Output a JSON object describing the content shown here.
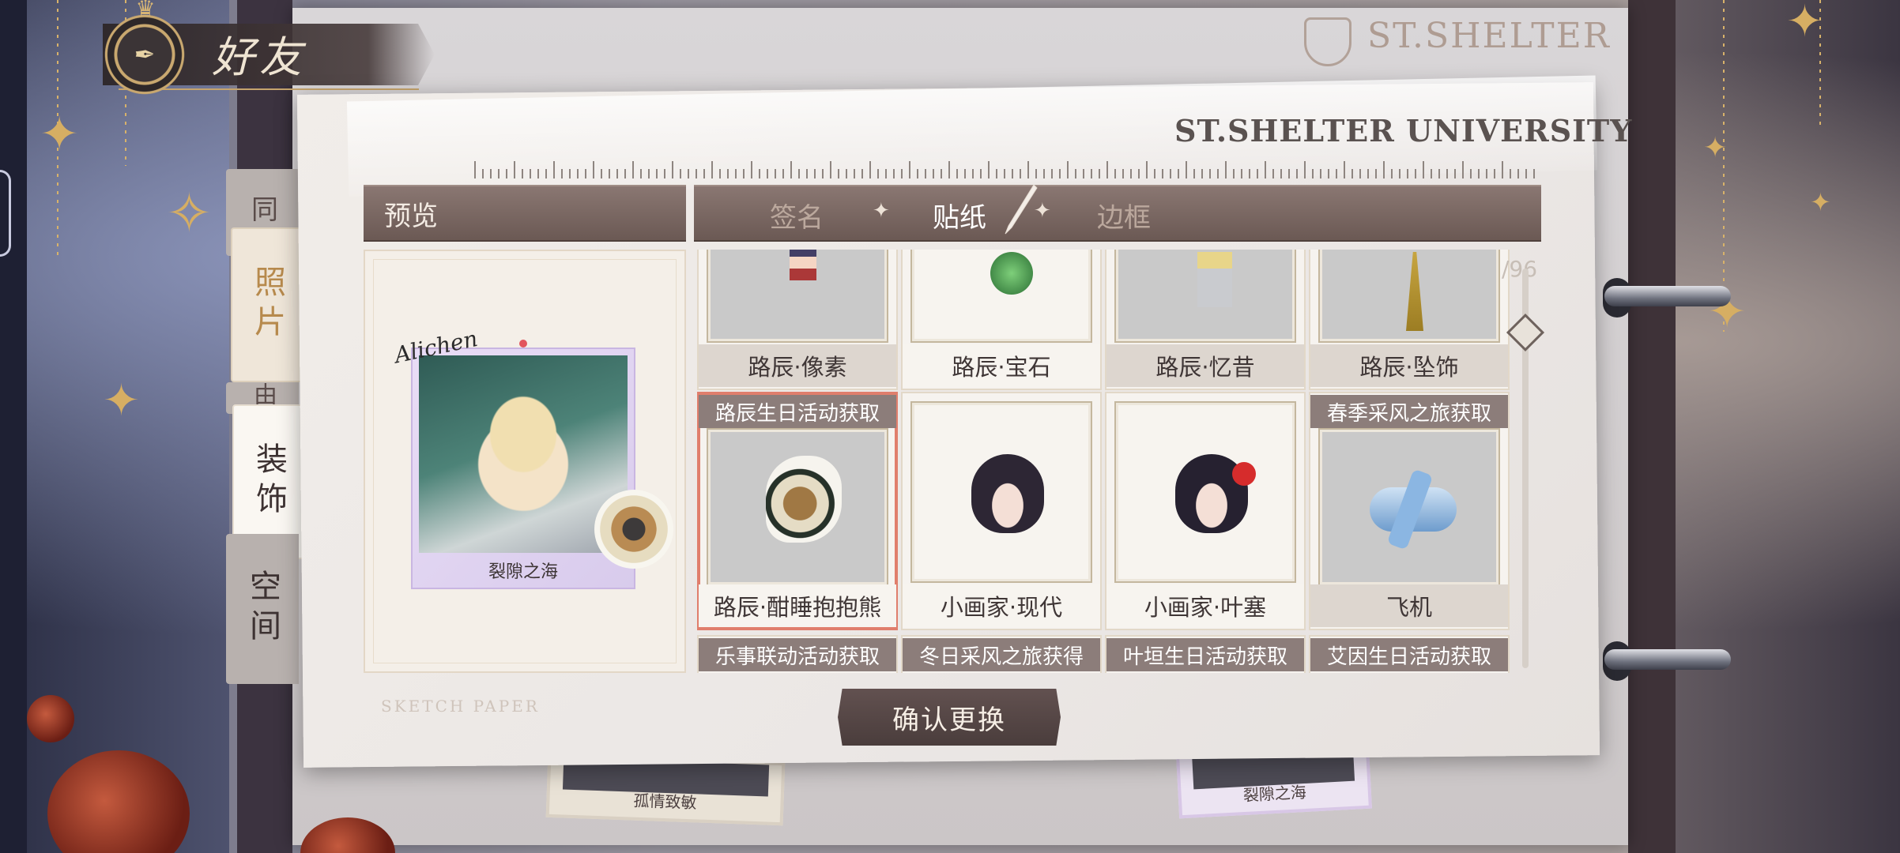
{
  "header": {
    "title": "好友"
  },
  "background": {
    "logo_text": "ST.SHELTER"
  },
  "side_tabs": [
    {
      "label": "同"
    },
    {
      "label": "照片"
    },
    {
      "label": "由"
    },
    {
      "label": "装饰"
    },
    {
      "label": "空间"
    }
  ],
  "panel": {
    "university": "ST.SHELTER UNIVERSITY",
    "preview_label": "预览",
    "tabs": [
      {
        "label": "签名",
        "active": false
      },
      {
        "label": "贴纸",
        "active": true
      },
      {
        "label": "边框",
        "active": false
      }
    ],
    "preview": {
      "signature": "Alichen",
      "caption": "裂隙之海"
    },
    "sketch_label": "SKETCH PAPER",
    "count_ghost": "/96",
    "confirm_label": "确认更换"
  },
  "stickers": {
    "row1": [
      {
        "name": "路辰·像素",
        "icon": "pixel-sticker-icon"
      },
      {
        "name": "路辰·宝石",
        "icon": "gem-sticker-icon"
      },
      {
        "name": "路辰·忆昔",
        "icon": "memory-sticker-icon"
      },
      {
        "name": "路辰·坠饰",
        "icon": "tassel-sticker-icon"
      }
    ],
    "row2": [
      {
        "source": "路辰生日活动获取",
        "name": "路辰·酣睡抱抱熊",
        "icon": "bear-sticker-icon",
        "selected": true
      },
      {
        "source": "",
        "name": "小画家·现代",
        "icon": "girl-modern-sticker-icon",
        "selected": false
      },
      {
        "source": "",
        "name": "小画家·叶塞",
        "icon": "girl-yesai-sticker-icon",
        "selected": false
      },
      {
        "source": "春季采风之旅获取",
        "name": "飞机",
        "icon": "plane-sticker-icon",
        "selected": false
      }
    ],
    "row3_sources": [
      "乐事联动活动获取",
      "冬日采风之旅获得",
      "叶垣生日活动获取",
      "艾因生日活动获取"
    ]
  },
  "background_peek": [
    {
      "caption": "孤情致敏"
    },
    {
      "caption": "裂隙之海"
    }
  ],
  "colors": {
    "header_bar": "#6b5954",
    "selected_border": "#e07e6c",
    "confirm_button": "#4a3d3c"
  }
}
